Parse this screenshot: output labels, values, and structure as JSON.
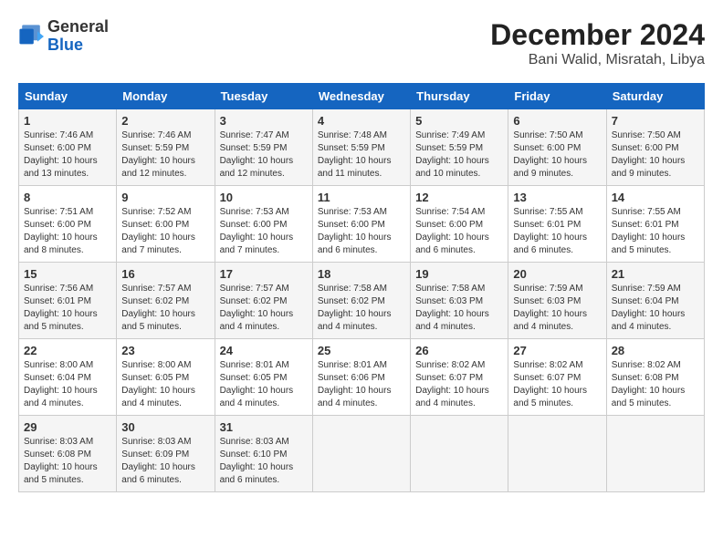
{
  "header": {
    "logo_general": "General",
    "logo_blue": "Blue",
    "month_year": "December 2024",
    "location": "Bani Walid, Misratah, Libya"
  },
  "days_of_week": [
    "Sunday",
    "Monday",
    "Tuesday",
    "Wednesday",
    "Thursday",
    "Friday",
    "Saturday"
  ],
  "weeks": [
    [
      {
        "day": "1",
        "sunrise": "7:46 AM",
        "sunset": "6:00 PM",
        "daylight": "10 hours and 13 minutes."
      },
      {
        "day": "2",
        "sunrise": "7:46 AM",
        "sunset": "5:59 PM",
        "daylight": "10 hours and 12 minutes."
      },
      {
        "day": "3",
        "sunrise": "7:47 AM",
        "sunset": "5:59 PM",
        "daylight": "10 hours and 12 minutes."
      },
      {
        "day": "4",
        "sunrise": "7:48 AM",
        "sunset": "5:59 PM",
        "daylight": "10 hours and 11 minutes."
      },
      {
        "day": "5",
        "sunrise": "7:49 AM",
        "sunset": "5:59 PM",
        "daylight": "10 hours and 10 minutes."
      },
      {
        "day": "6",
        "sunrise": "7:50 AM",
        "sunset": "6:00 PM",
        "daylight": "10 hours and 9 minutes."
      },
      {
        "day": "7",
        "sunrise": "7:50 AM",
        "sunset": "6:00 PM",
        "daylight": "10 hours and 9 minutes."
      }
    ],
    [
      {
        "day": "8",
        "sunrise": "7:51 AM",
        "sunset": "6:00 PM",
        "daylight": "10 hours and 8 minutes."
      },
      {
        "day": "9",
        "sunrise": "7:52 AM",
        "sunset": "6:00 PM",
        "daylight": "10 hours and 7 minutes."
      },
      {
        "day": "10",
        "sunrise": "7:53 AM",
        "sunset": "6:00 PM",
        "daylight": "10 hours and 7 minutes."
      },
      {
        "day": "11",
        "sunrise": "7:53 AM",
        "sunset": "6:00 PM",
        "daylight": "10 hours and 6 minutes."
      },
      {
        "day": "12",
        "sunrise": "7:54 AM",
        "sunset": "6:00 PM",
        "daylight": "10 hours and 6 minutes."
      },
      {
        "day": "13",
        "sunrise": "7:55 AM",
        "sunset": "6:01 PM",
        "daylight": "10 hours and 6 minutes."
      },
      {
        "day": "14",
        "sunrise": "7:55 AM",
        "sunset": "6:01 PM",
        "daylight": "10 hours and 5 minutes."
      }
    ],
    [
      {
        "day": "15",
        "sunrise": "7:56 AM",
        "sunset": "6:01 PM",
        "daylight": "10 hours and 5 minutes."
      },
      {
        "day": "16",
        "sunrise": "7:57 AM",
        "sunset": "6:02 PM",
        "daylight": "10 hours and 5 minutes."
      },
      {
        "day": "17",
        "sunrise": "7:57 AM",
        "sunset": "6:02 PM",
        "daylight": "10 hours and 4 minutes."
      },
      {
        "day": "18",
        "sunrise": "7:58 AM",
        "sunset": "6:02 PM",
        "daylight": "10 hours and 4 minutes."
      },
      {
        "day": "19",
        "sunrise": "7:58 AM",
        "sunset": "6:03 PM",
        "daylight": "10 hours and 4 minutes."
      },
      {
        "day": "20",
        "sunrise": "7:59 AM",
        "sunset": "6:03 PM",
        "daylight": "10 hours and 4 minutes."
      },
      {
        "day": "21",
        "sunrise": "7:59 AM",
        "sunset": "6:04 PM",
        "daylight": "10 hours and 4 minutes."
      }
    ],
    [
      {
        "day": "22",
        "sunrise": "8:00 AM",
        "sunset": "6:04 PM",
        "daylight": "10 hours and 4 minutes."
      },
      {
        "day": "23",
        "sunrise": "8:00 AM",
        "sunset": "6:05 PM",
        "daylight": "10 hours and 4 minutes."
      },
      {
        "day": "24",
        "sunrise": "8:01 AM",
        "sunset": "6:05 PM",
        "daylight": "10 hours and 4 minutes."
      },
      {
        "day": "25",
        "sunrise": "8:01 AM",
        "sunset": "6:06 PM",
        "daylight": "10 hours and 4 minutes."
      },
      {
        "day": "26",
        "sunrise": "8:02 AM",
        "sunset": "6:07 PM",
        "daylight": "10 hours and 4 minutes."
      },
      {
        "day": "27",
        "sunrise": "8:02 AM",
        "sunset": "6:07 PM",
        "daylight": "10 hours and 5 minutes."
      },
      {
        "day": "28",
        "sunrise": "8:02 AM",
        "sunset": "6:08 PM",
        "daylight": "10 hours and 5 minutes."
      }
    ],
    [
      {
        "day": "29",
        "sunrise": "8:03 AM",
        "sunset": "6:08 PM",
        "daylight": "10 hours and 5 minutes."
      },
      {
        "day": "30",
        "sunrise": "8:03 AM",
        "sunset": "6:09 PM",
        "daylight": "10 hours and 6 minutes."
      },
      {
        "day": "31",
        "sunrise": "8:03 AM",
        "sunset": "6:10 PM",
        "daylight": "10 hours and 6 minutes."
      },
      null,
      null,
      null,
      null
    ]
  ]
}
